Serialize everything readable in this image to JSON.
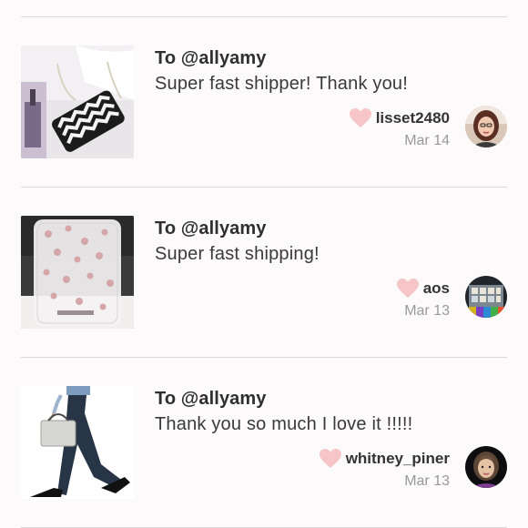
{
  "reviews": [
    {
      "recipient": "To @allyamy",
      "message": "Super fast shipper! Thank you!",
      "username": "lisset2480",
      "date": "Mar 14",
      "thumb_icon": "chevron-phone-case-photo",
      "avatar_icon": "user-avatar-photo"
    },
    {
      "recipient": "To @allyamy",
      "message": "Super fast shipping!",
      "username": "aos",
      "date": "Mar 13",
      "thumb_icon": "polka-dot-clear-case-photo",
      "avatar_icon": "user-avatar-photo"
    },
    {
      "recipient": "To @allyamy",
      "message": "Thank you so much I love it !!!!!",
      "username": "whitney_piner",
      "date": "Mar 13",
      "thumb_icon": "handbag-model-photo",
      "avatar_icon": "user-avatar-photo"
    }
  ],
  "colors": {
    "heart": "#f6c5c8",
    "date_text": "#9a9a9a",
    "divider": "#dcd7d7",
    "background": "#fcfafa"
  }
}
